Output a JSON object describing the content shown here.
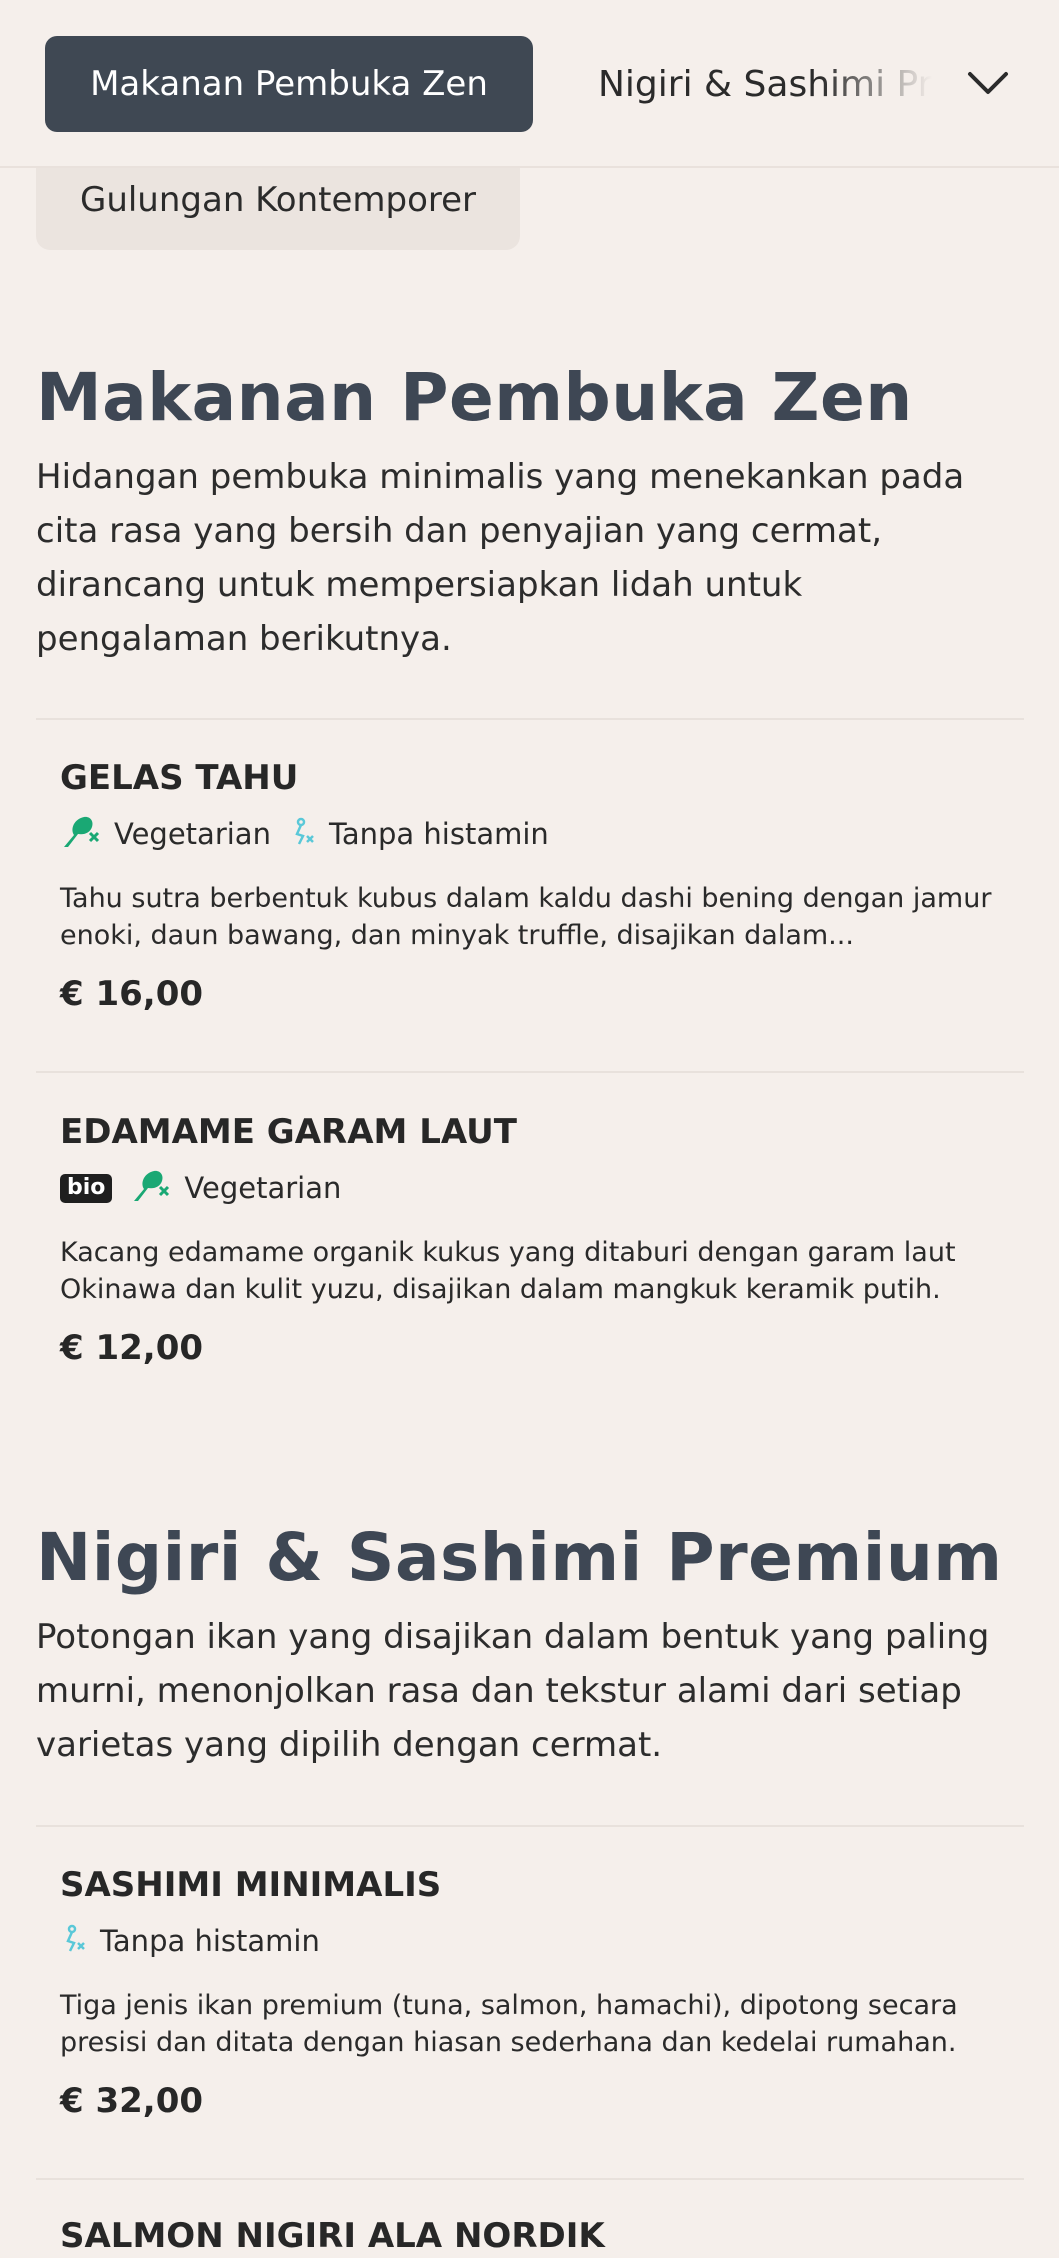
{
  "nav": {
    "active_tab": "Makanan Pembuka Zen",
    "next_tab": "Nigiri & Sashimi Premium",
    "second_row_tab": "Gulungan Kontemporer"
  },
  "sections": [
    {
      "title": "Makanan Pembuka Zen",
      "description": "Hidangan pembuka minimalis yang menekankan pada cita rasa yang bersih dan penyajian yang cermat, dirancang untuk mempersiapkan lidah untuk pengalaman berikutnya.",
      "items": [
        {
          "name": "GELAS TAHU",
          "tags": [
            "Vegetarian",
            "Tanpa histamin"
          ],
          "description": "Tahu sutra berbentuk kubus dalam kaldu dashi bening dengan jamur enoki, daun bawang, dan minyak truffle, disajikan dalam...",
          "price": "€ 16,00"
        },
        {
          "name": "EDAMAME GARAM LAUT",
          "badge": "bio",
          "tags": [
            "Vegetarian"
          ],
          "description": "Kacang edamame organik kukus yang ditaburi dengan garam laut Okinawa dan kulit yuzu, disajikan dalam mangkuk keramik putih.",
          "price": "€ 12,00"
        }
      ]
    },
    {
      "title": "Nigiri & Sashimi Premium",
      "description": "Potongan ikan yang disajikan dalam bentuk yang paling murni, menonjolkan rasa dan tekstur alami dari setiap varietas yang dipilih dengan cermat.",
      "items": [
        {
          "name": "SASHIMI MINIMALIS",
          "tags": [
            "Tanpa histamin"
          ],
          "description": "Tiga jenis ikan premium (tuna, salmon, hamachi), dipotong secara presisi dan ditata dengan hiasan sederhana dan kedelai rumahan.",
          "price": "€ 32,00"
        },
        {
          "name": "SALMON NIGIRI ALA NORDIK"
        }
      ]
    }
  ],
  "colors": {
    "background": "#f5efeb",
    "active_tab": "#3f4853",
    "section_title": "#3e4754",
    "vegetarian_icon": "#1aa874",
    "histamine_icon": "#5ac8d8"
  }
}
